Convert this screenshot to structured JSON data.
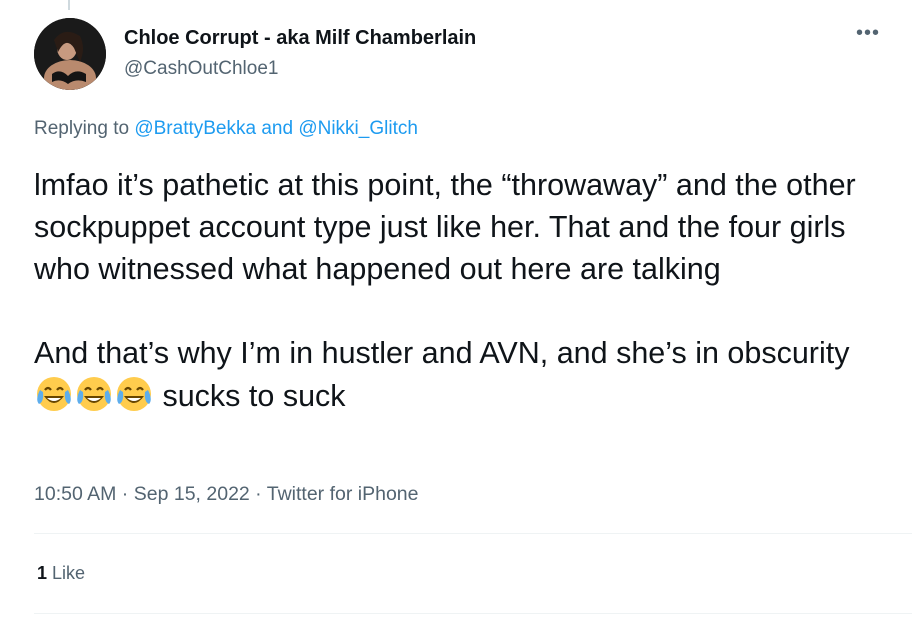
{
  "tweet": {
    "author": {
      "display_name": "Chloe Corrupt - aka Milf Chamberlain",
      "handle": "@CashOutChloe1"
    },
    "more_icon": "more-horizontal-icon",
    "replying": {
      "prefix": "Replying to ",
      "users": [
        "@BrattyBekka",
        "@Nikki_Glitch"
      ],
      "joiner": " and "
    },
    "text": {
      "paragraph1": "lmfao it’s pathetic at this point, the “throwaway” and the other sockpuppet account type just like her. That and the four girls who witnessed what happened out here are talking",
      "paragraph2_before": "And that’s why I’m in hustler and AVN, and she’s in obscurity ",
      "emojis": [
        "face-with-tears-of-joy",
        "face-with-tears-of-joy",
        "face-with-tears-of-joy"
      ],
      "paragraph2_after": " sucks to suck"
    },
    "meta": {
      "time": "10:50 AM",
      "separator": " · ",
      "date": "Sep 15, 2022",
      "source": "Twitter for iPhone"
    },
    "stats": {
      "likes_count": "1",
      "likes_label": " Like"
    },
    "colors": {
      "link": "#1d9bf0",
      "secondary": "#536471",
      "primary": "#0f1419",
      "divider": "#eff3f4"
    }
  }
}
